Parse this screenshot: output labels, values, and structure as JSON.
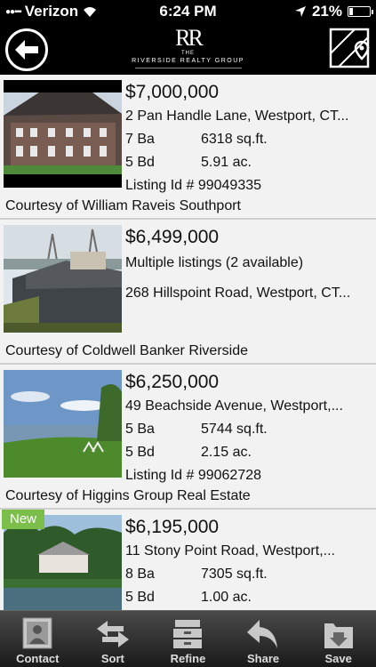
{
  "status": {
    "carrier": "Verizon",
    "time": "6:24 PM",
    "battery": "21%",
    "battery_level": 0.21
  },
  "header": {
    "logo_mark": "RR",
    "logo_the": "THE",
    "logo_name": "RIVERSIDE REALTY GROUP"
  },
  "listings": [
    {
      "price": "$7,000,000",
      "address": "2 Pan Handle Lane, Westport, CT...",
      "baths": "7 Ba",
      "sqft": "6318 sq.ft.",
      "beds": "5 Bd",
      "acres": "5.91 ac.",
      "listing_id": "Listing Id # 99049335",
      "courtesy": "Courtesy of William Raveis Southport"
    },
    {
      "price": "$6,499,000",
      "multiple": "Multiple listings (2 available)",
      "address": "268 Hillspoint Road, Westport, CT...",
      "courtesy": "Courtesy of Coldwell Banker Riverside"
    },
    {
      "price": "$6,250,000",
      "address": "49 Beachside Avenue, Westport,...",
      "baths": "5 Ba",
      "sqft": "5744 sq.ft.",
      "beds": "5 Bd",
      "acres": "2.15 ac.",
      "listing_id": "Listing Id # 99062728",
      "courtesy": "Courtesy of Higgins Group Real Estate"
    },
    {
      "badge": "New",
      "price": "$6,195,000",
      "address": "11 Stony Point Road, Westport,...",
      "baths": "8 Ba",
      "sqft": "7305 sq.ft.",
      "beds": "5 Bd",
      "acres": "1.00 ac."
    }
  ],
  "tabs": {
    "contact": "Contact",
    "sort": "Sort",
    "refine": "Refine",
    "share": "Share",
    "save": "Save"
  }
}
